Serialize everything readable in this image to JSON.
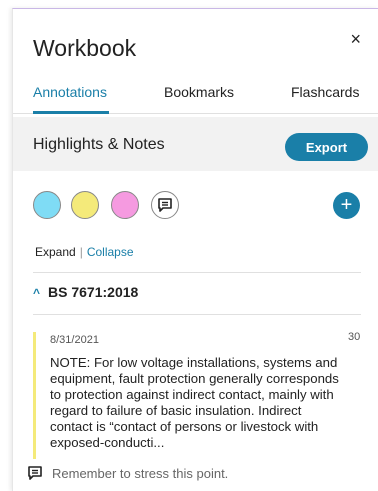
{
  "panel": {
    "title": "Workbook",
    "close_label": "×"
  },
  "tabs": [
    {
      "label": "Annotations",
      "active": true
    },
    {
      "label": "Bookmarks",
      "active": false
    },
    {
      "label": "Flashcards",
      "active": false
    }
  ],
  "highlights": {
    "title": "Highlights & Notes",
    "export_label": "Export"
  },
  "swatches": {
    "colors": [
      "#7fdcf5",
      "#f4ea7a",
      "#f59ae0"
    ],
    "note_icon": "comment-icon",
    "add_label": "+"
  },
  "toggle": {
    "expand_label": "Expand",
    "separator": "|",
    "collapse_label": "Collapse"
  },
  "group": {
    "chevron": "^",
    "title": "BS 7671:2018"
  },
  "annotation": {
    "date": "8/31/2021",
    "page": "30",
    "text": "NOTE: For low voltage installations, systems and equipment, fault protection generally corresponds to protection against indirect contact, mainly with regard to failure of basic insulation. Indirect contact is “contact of persons or livestock with exposed-conducti...",
    "highlight_color": "#f4ea7a",
    "note": "Remember to stress this point."
  }
}
